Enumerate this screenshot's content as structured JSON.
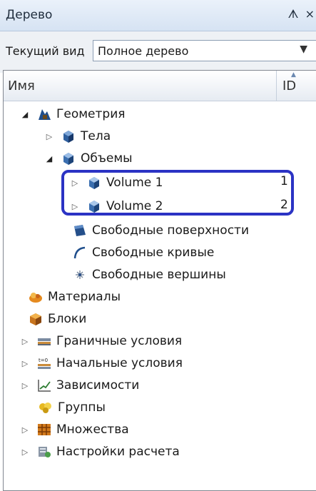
{
  "panel": {
    "title": "Дерево",
    "buttons": "ᗑ ×"
  },
  "view": {
    "label": "Текущий вид",
    "value": "Полное дерево"
  },
  "columns": {
    "name": "Имя",
    "id": "ID"
  },
  "tree": {
    "geometry": "Геометрия",
    "bodies": "Тела",
    "volumes": "Объемы",
    "volume1": {
      "name": "Volume 1",
      "id": "1"
    },
    "volume2": {
      "name": "Volume 2",
      "id": "2"
    },
    "free_surfaces": "Свободные поверхности",
    "free_curves": "Свободные кривые",
    "free_vertices": "Свободные вершины",
    "materials": "Материалы",
    "blocks": "Блоки",
    "boundary_conditions": "Граничные условия",
    "initial_conditions": "Начальные условия",
    "dependencies": "Зависимости",
    "groups": "Группы",
    "sets": "Множества",
    "analysis_settings": "Настройки расчета"
  },
  "icons": {
    "geometry": "geometry-icon",
    "bodies": "bodies-icon",
    "volumes": "volumes-icon",
    "volume": "cube-icon",
    "free_surfaces": "surface-icon",
    "free_curves": "curve-icon",
    "free_vertices": "vertex-icon",
    "materials": "material-icon",
    "blocks": "block-icon",
    "boundary_conditions": "boundary-condition-icon",
    "initial_conditions": "initial-condition-icon",
    "dependencies": "dependency-chart-icon",
    "groups": "groups-icon",
    "sets": "sets-icon",
    "analysis_settings": "settings-icon"
  },
  "colors": {
    "highlight": "#2b33c4",
    "cube": "#3b6fb0",
    "select_border": "#8c9db3"
  }
}
